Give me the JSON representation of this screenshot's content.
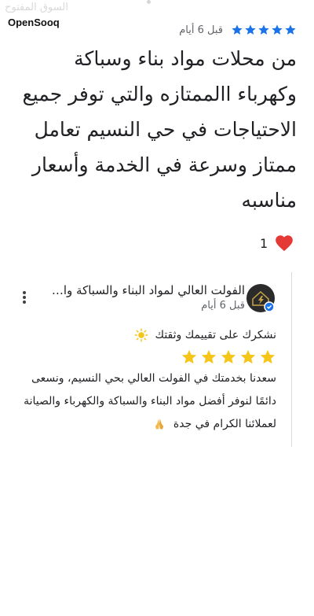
{
  "watermark": {
    "ghost_text": "السوق المفتوح",
    "logo_text": "OpenSooq"
  },
  "review": {
    "rating": 5,
    "rating_color": "#1a73e8",
    "time": "قبل 6 أيام",
    "lines": [
      "من محلات مواد بناء وسباكة",
      "وكهرباء االممتازه والتي توفر جميع",
      "الاحتياجات في حي النسيم  تعامل",
      "ممتاز وسرعة في الخدمة وأسعار",
      "مناسبه"
    ]
  },
  "reaction": {
    "icon": "heart-icon",
    "count": "1",
    "color": "#e53935"
  },
  "owner_reply": {
    "business_name": "الفولت العالي لمواد البناء والسباكة وال...",
    "time": "قبل 6 أيام",
    "verified_color": "#1a73e8",
    "line1": "نشكرك على تقييمك وثقتك",
    "emoji_line1": "glowing-star-emoji",
    "star_emojis": 5,
    "line3": "سعدنا بخدمتك في الفولت العالي بحي النسيم، ونسعى",
    "line4": "دائمًا لنوفر أفضل مواد البناء والسباكة والكهرباء والصيانة",
    "line5": "لعملائنا الكرام في جدة",
    "emoji_line5": "folded-hands-emoji"
  }
}
